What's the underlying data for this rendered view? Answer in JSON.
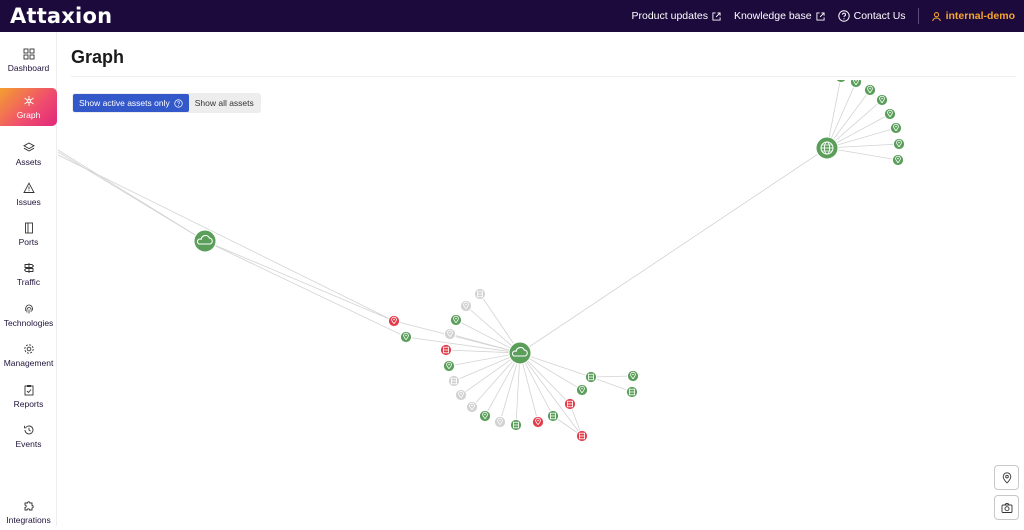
{
  "header": {
    "brand": "Attaxion",
    "links": [
      {
        "label": "Product updates",
        "icon": "external-link-icon"
      },
      {
        "label": "Knowledge base",
        "icon": "external-link-icon"
      },
      {
        "label": "Contact Us",
        "icon": "question-circle-icon"
      }
    ],
    "user": "internal-demo"
  },
  "sidebar": {
    "items": [
      {
        "label": "Dashboard",
        "icon": "dashboard-icon"
      },
      {
        "label": "Graph",
        "icon": "graph-icon",
        "active": true
      },
      {
        "label": "Assets",
        "icon": "layers-icon"
      },
      {
        "label": "Issues",
        "icon": "warning-icon"
      },
      {
        "label": "Ports",
        "icon": "door-icon"
      },
      {
        "label": "Traffic",
        "icon": "signpost-icon"
      },
      {
        "label": "Technologies",
        "icon": "fingerprint-icon"
      },
      {
        "label": "Management",
        "icon": "gear-icon"
      },
      {
        "label": "Reports",
        "icon": "clipboard-icon"
      },
      {
        "label": "Events",
        "icon": "history-icon"
      },
      {
        "label": "Integrations",
        "icon": "puzzle-icon"
      }
    ]
  },
  "main": {
    "title": "Graph",
    "toggle": {
      "active_label": "Show active assets only",
      "inactive_label": "Show all assets"
    }
  },
  "colors": {
    "topbar": "#1b0a3b",
    "accent_orange": "#f7a530",
    "toggle_blue": "#3358c9",
    "node_green": "#5a9e5a",
    "node_red": "#e23b4a",
    "node_gray": "#d2d2d2"
  },
  "graph_tools": [
    {
      "icon": "location-pin-icon"
    },
    {
      "icon": "camera-icon"
    }
  ]
}
